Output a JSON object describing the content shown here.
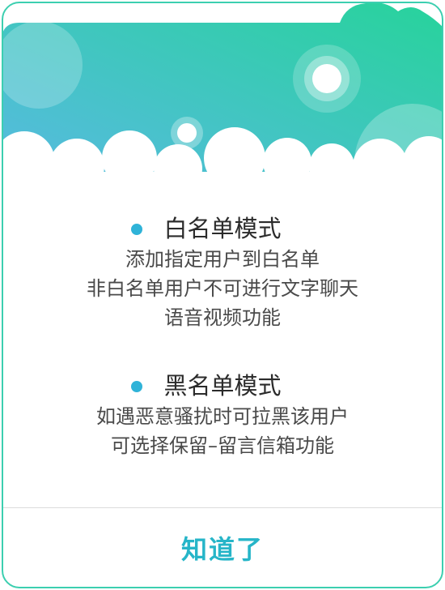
{
  "colors": {
    "gradient_start": "#5ab9e4",
    "gradient_end": "#27d39b",
    "bullet": "#2fb3d8",
    "button_text": "#26b5c8",
    "border": "#3ccfb0"
  },
  "whitelist": {
    "title": "白名单模式",
    "lines": [
      "添加指定用户到白名单",
      "非白名单用户不可进行文字聊天",
      "语音视频功能"
    ]
  },
  "blacklist": {
    "title": "黑名单模式",
    "lines": [
      "如遇恶意骚扰时可拉黑该用户",
      "可选择保留–留言信箱功能"
    ]
  },
  "button": {
    "label": "知道了"
  }
}
